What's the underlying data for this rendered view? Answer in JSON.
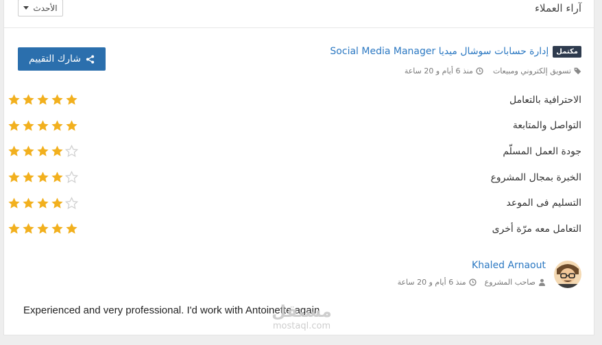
{
  "header": {
    "title": "آراء العملاء",
    "sort_label": "الأحدث"
  },
  "share_button": {
    "label": "شارك التقييم",
    "icon": "share-icon"
  },
  "project": {
    "badge": "مكتمل",
    "title": "إدارة حسابات سوشال ميديا Social Media Manager",
    "category": "تسويق إلكتروني ومبيعات",
    "time": "منذ 6 أيام و 20 ساعة"
  },
  "ratings": [
    {
      "label": "الاحترافية بالتعامل",
      "stars": 5
    },
    {
      "label": "التواصل والمتابعة",
      "stars": 5
    },
    {
      "label": "جودة العمل المسلّم",
      "stars": 4
    },
    {
      "label": "الخبرة بمجال المشروع",
      "stars": 4
    },
    {
      "label": "التسليم فى الموعد",
      "stars": 4
    },
    {
      "label": "التعامل معه مرّة أخرى",
      "stars": 5
    }
  ],
  "reviewer": {
    "name": "Khaled Arnaout",
    "role": "صاحب المشروع",
    "time": "منذ 6 أيام و 20 ساعة"
  },
  "review_text": "Experienced and very professional. I'd work with Antoinette again",
  "watermark": {
    "arabic": "مستقل",
    "latin": "mostaql.com"
  },
  "colors": {
    "star_filled": "#f2b01e",
    "star_empty": "#cfcfcf",
    "accent": "#2b6fad",
    "link": "#2b78c2"
  }
}
